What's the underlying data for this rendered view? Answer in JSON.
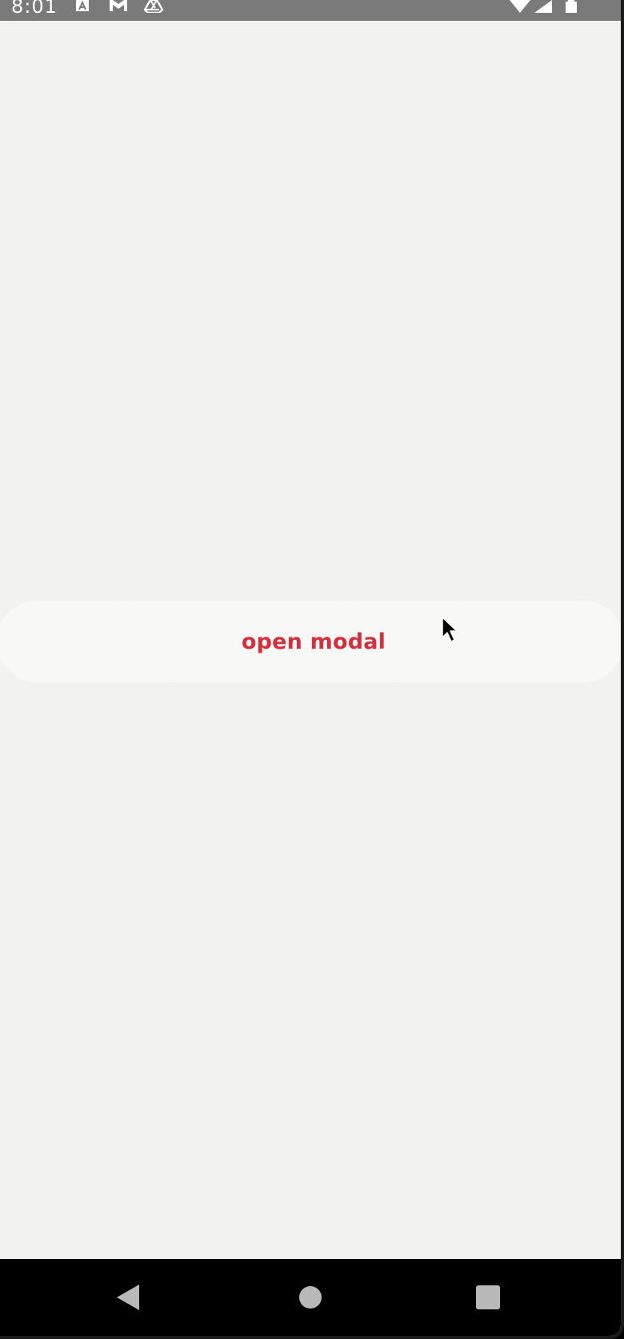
{
  "status_bar": {
    "time": "8:01",
    "icons": [
      "app-a-icon",
      "gmail-icon",
      "drive-icon",
      "wifi-icon",
      "signal-icon",
      "battery-icon"
    ]
  },
  "main": {
    "open_modal_button": {
      "label": "open modal"
    }
  },
  "nav_bar": {
    "icons": [
      "back-icon",
      "home-icon",
      "recents-icon"
    ]
  },
  "colors": {
    "accent": "#d2303d",
    "background": "#f3f3f1",
    "button_background": "#f8f8f6",
    "status_bar": "#7a7a7a",
    "nav_bar": "#000000"
  }
}
